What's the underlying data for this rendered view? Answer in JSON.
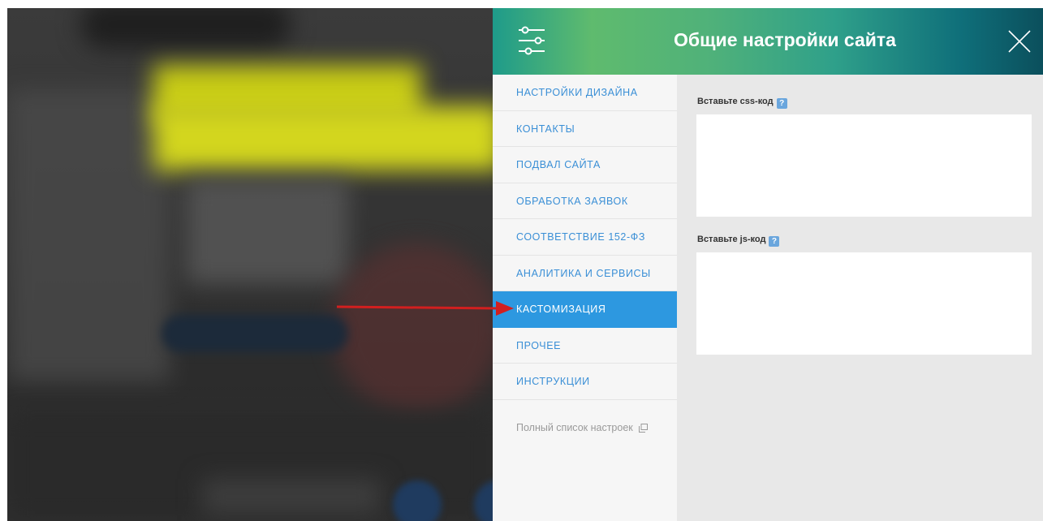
{
  "panel": {
    "title": "Общие настройки сайта"
  },
  "menu": {
    "items": [
      {
        "label": "НАСТРОЙКИ ДИЗАЙНА",
        "active": false
      },
      {
        "label": "КОНТАКТЫ",
        "active": false
      },
      {
        "label": "ПОДВАЛ САЙТА",
        "active": false
      },
      {
        "label": "ОБРАБОТКА ЗАЯВОК",
        "active": false
      },
      {
        "label": "СООТВЕТСТВИЕ 152-ФЗ",
        "active": false
      },
      {
        "label": "АНАЛИТИКА И СЕРВИСЫ",
        "active": false
      },
      {
        "label": "КАСТОМИЗАЦИЯ",
        "active": true
      },
      {
        "label": "ПРОЧЕЕ",
        "active": false
      },
      {
        "label": "ИНСТРУКЦИИ",
        "active": false
      }
    ],
    "full_list": "Полный список настроек"
  },
  "content": {
    "css_label": "Вставьте css-код",
    "css_value": "",
    "js_label": "Вставьте js-код",
    "js_value": "",
    "help_glyph": "?"
  },
  "colors": {
    "accent": "#2d98e0",
    "menu_text": "#3a8fd6",
    "arrow": "#d21f1f"
  },
  "icons": {
    "header_left": "sliders-icon",
    "header_right": "close-icon",
    "external": "external-link-icon"
  }
}
